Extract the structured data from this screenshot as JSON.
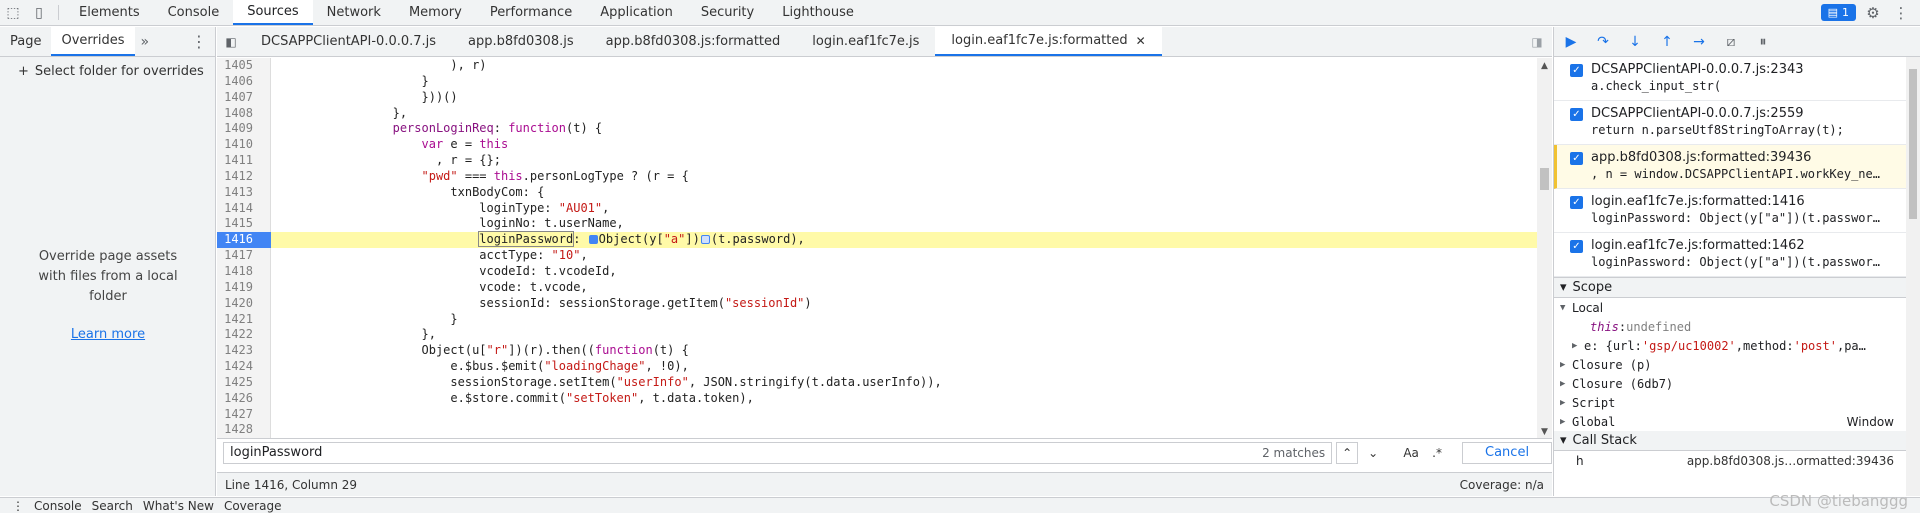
{
  "topbar": {
    "tabs": [
      "Elements",
      "Console",
      "Sources",
      "Network",
      "Memory",
      "Performance",
      "Application",
      "Security",
      "Lighthouse"
    ],
    "active_tab": "Sources",
    "issues_count": "1"
  },
  "navigator": {
    "tabs": [
      "Page",
      "Overrides"
    ],
    "active_tab": "Overrides",
    "select_folder": "Select folder for overrides",
    "message": "Override page assets with files from a local folder",
    "learn_more": "Learn more"
  },
  "file_tabs": [
    {
      "label": "DCSAPPClientAPI-0.0.0.7.js"
    },
    {
      "label": "app.b8fd0308.js"
    },
    {
      "label": "app.b8fd0308.js:formatted"
    },
    {
      "label": "login.eaf1fc7e.js"
    },
    {
      "label": "login.eaf1fc7e.js:formatted",
      "active": true
    }
  ],
  "code": {
    "highlight_line": 1416,
    "lines": [
      {
        "n": "1405",
        "html": "                        ), r)"
      },
      {
        "n": "1406",
        "html": "                    }"
      },
      {
        "n": "1407",
        "html": "                    }))()"
      },
      {
        "n": "1408",
        "html": "                },"
      },
      {
        "n": "1409",
        "html": "                <span class=\"prop\">personLoginReq</span>: <span class=\"kw\">function</span>(t) {"
      },
      {
        "n": "1410",
        "html": "                    <span class=\"kw\">var</span> e = <span class=\"kw\">this</span>"
      },
      {
        "n": "1411",
        "html": "                      , r = {};"
      },
      {
        "n": "1412",
        "html": "                    <span class=\"str\">\"pwd\"</span> === <span class=\"kw\">this</span>.personLogType ? (r = {"
      },
      {
        "n": "1413",
        "html": "                        txnBodyCom: {"
      },
      {
        "n": "1414",
        "html": "                            loginType: <span class=\"str\">\"AU01\"</span>,"
      },
      {
        "n": "1415",
        "html": "                            loginNo: t.userName,"
      },
      {
        "n": "1416",
        "html": "                            <span class=\"boxed\">loginPassword</span>: <span class=\"bp-marker\"></span>Object(y[<span class=\"str\">\"a\"</span>])<span class=\"bp-marker hollow\"></span>(t.password),"
      },
      {
        "n": "1417",
        "html": "                            acctType: <span class=\"str\">\"10\"</span>,"
      },
      {
        "n": "1418",
        "html": "                            vcodeId: t.vcodeId,"
      },
      {
        "n": "1419",
        "html": "                            vcode: t.vcode,"
      },
      {
        "n": "1420",
        "html": "                            sessionId: sessionStorage.getItem(<span class=\"str\">\"sessionId\"</span>)"
      },
      {
        "n": "1421",
        "html": "                        }"
      },
      {
        "n": "1422",
        "html": "                    },"
      },
      {
        "n": "1423",
        "html": "                    Object(u[<span class=\"str\">\"r\"</span>])(r).then((<span class=\"kw\">function</span>(t) {"
      },
      {
        "n": "1424",
        "html": "                        e.$bus.$emit(<span class=\"str\">\"loadingChage\"</span>, !0),"
      },
      {
        "n": "1425",
        "html": "                        sessionStorage.setItem(<span class=\"str\">\"userInfo\"</span>, JSON.stringify(t.data.userInfo)),"
      },
      {
        "n": "1426",
        "html": "                        e.$store.commit(<span class=\"str\">\"setToken\"</span>, t.data.token),"
      },
      {
        "n": "1427",
        "html": ""
      },
      {
        "n": "1428",
        "html": ""
      }
    ]
  },
  "search": {
    "query": "loginPassword",
    "matches": "2 matches",
    "match_case": "Aa",
    "regex": ".*",
    "cancel": "Cancel"
  },
  "status": {
    "position": "Line 1416, Column 29",
    "coverage": "Coverage: n/a"
  },
  "breakpoints": [
    {
      "loc": "DCSAPPClientAPI-0.0.0.7.js:2343",
      "code": "a.check_input_str("
    },
    {
      "loc": "DCSAPPClientAPI-0.0.0.7.js:2559",
      "code": "return n.parseUtf8StringToArray(t);"
    },
    {
      "loc": "app.b8fd0308.js:formatted:39436",
      "code": ", n = window.DCSAPPClientAPI.workKey_ne…",
      "paused": true
    },
    {
      "loc": "login.eaf1fc7e.js:formatted:1416",
      "code": "loginPassword: Object(y[\"a\"])(t.passwor…"
    },
    {
      "loc": "login.eaf1fc7e.js:formatted:1462",
      "code": "loginPassword: Object(y[\"a\"])(t.passwor…"
    }
  ],
  "scope": {
    "title": "Scope",
    "local": "Local",
    "this_key": "this",
    "this_val": "undefined",
    "e_key": "e",
    "e_url_key": "url",
    "e_url": "'gsp/uc10002'",
    "e_method_key": "method",
    "e_method": "'post'",
    "e_more": "pa…",
    "closure1": "Closure (p)",
    "closure2": "Closure (6db7)",
    "script": "Script",
    "global": "Global",
    "global_val": "Window"
  },
  "callstack": {
    "title": "Call Stack",
    "frame_name": "h",
    "frame_loc": "app.b8fd0308.js…ormatted:39436"
  },
  "drawer": {
    "items": [
      "Console",
      "Search",
      "What's New",
      "Coverage"
    ]
  },
  "watermark": "CSDN @tiebanggg"
}
